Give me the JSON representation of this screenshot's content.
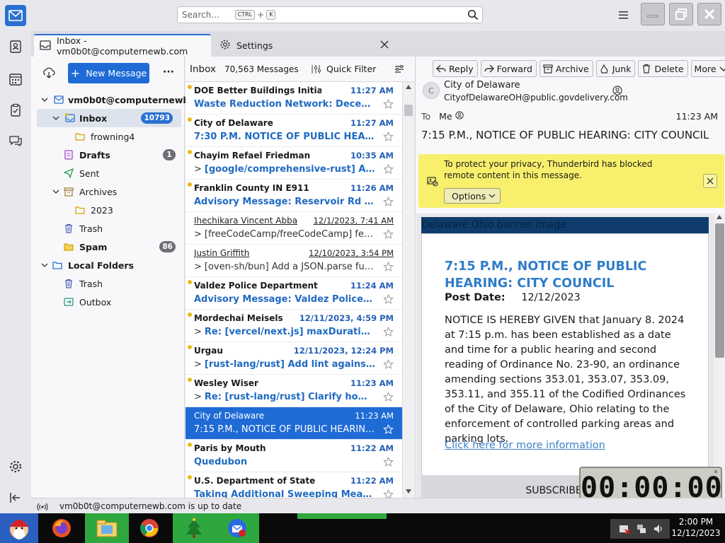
{
  "toolbar_top": {
    "search_placeholder": "Search...",
    "search_key1": "CTRL",
    "search_plus": "+",
    "search_key2": "K"
  },
  "tabs": [
    {
      "label": "Inbox - vm0b0t@computernewb.com"
    },
    {
      "label": "Settings"
    }
  ],
  "folder_pane": {
    "new_message": "New Message",
    "account": "vm0b0t@computernewb....",
    "folders": [
      {
        "label": "Inbox",
        "badge": "10793"
      },
      {
        "label": "frowning4",
        "badge": ""
      },
      {
        "label": "Drafts",
        "badge": "1"
      },
      {
        "label": "Sent",
        "badge": ""
      },
      {
        "label": "Archives",
        "badge": ""
      },
      {
        "label": "2023",
        "badge": ""
      },
      {
        "label": "Trash",
        "badge": ""
      },
      {
        "label": "Spam",
        "badge": "86"
      },
      {
        "label": "Local Folders",
        "badge": ""
      },
      {
        "label": "Trash",
        "badge": ""
      },
      {
        "label": "Outbox",
        "badge": ""
      }
    ]
  },
  "message_list": {
    "title": "Inbox",
    "count": "70,563 Messages",
    "quick_filter": "Quick Filter",
    "messages": [
      {
        "from": "DOE Better Buildings Initiative",
        "date": "11:27 AM",
        "subject": "Waste Reduction Network: December 2...",
        "thread": false
      },
      {
        "from": "City of Delaware",
        "date": "11:27 AM",
        "subject": "7:30 P.M. NOTICE OF PUBLIC HEARING: ...",
        "thread": false
      },
      {
        "from": "Chayim Refael Friedman",
        "date": "10:35 AM",
        "subject": "[google/comprehensive-rust] Add ex...",
        "thread": true
      },
      {
        "from": "Franklin County IN E911",
        "date": "11:26 AM",
        "subject": "Advisory Message: Reservoir Rd just so...",
        "thread": false
      },
      {
        "from": "Ihechikara Vincent Abba",
        "date": "12/1/2023, 7:41 AM",
        "subject": "[freeCodeCamp/freeCodeCamp] feat(cu...",
        "thread": true
      },
      {
        "from": "Justin Griffith",
        "date": "12/10/2023, 3:54 PM",
        "subject": "[oven-sh/bun] Add a JSON.parse functio...",
        "thread": true
      },
      {
        "from": "Valdez Police Department",
        "date": "11:24 AM",
        "subject": "Advisory Message: Valdez Police Depart...",
        "thread": false
      },
      {
        "from": "Mordechai Meisels",
        "date": "12/11/2023, 4:59 PM",
        "subject": "Re: [vercel/next.js] maxDuration and ...",
        "thread": true
      },
      {
        "from": "Urgau",
        "date": "12/11/2023, 12:24 PM",
        "subject": "[rust-lang/rust] Add lint against func...",
        "thread": true
      },
      {
        "from": "Wesley Wiser",
        "date": "11:23 AM",
        "subject": "Re: [rust-lang/rust] Clarify how to ch...",
        "thread": true
      },
      {
        "from": "City of Delaware",
        "date": "11:23 AM",
        "subject": "7:15 P.M., NOTICE OF PUBLIC HEARING: CIT...",
        "thread": false
      },
      {
        "from": "Paris by Mouth",
        "date": "11:22 AM",
        "subject": "Quedubon",
        "thread": false
      },
      {
        "from": "U.S. Department of State",
        "date": "11:22 AM",
        "subject": "Taking Additional Sweeping Measures ...",
        "thread": false
      }
    ]
  },
  "reader": {
    "buttons": [
      "Reply",
      "Forward",
      "Archive",
      "Junk",
      "Delete",
      "More"
    ],
    "avatar_letter": "C",
    "from_name": "City of Delaware",
    "from_email": "CityofDelawareOH@public.govdelivery.com",
    "to_label": "To",
    "to_value": "Me",
    "time": "11:23 AM",
    "subject": "7:15 P.M., NOTICE OF PUBLIC HEARING: CITY COUNCIL",
    "privacy_text": "To protect your privacy, Thunderbird has blocked remote content in this message.",
    "options_label": "Options",
    "image_alt": "Delaware Ohio banner image",
    "notice_title": "7:15 P.M., NOTICE OF PUBLIC HEARING: CITY COUNCIL",
    "post_date_label": "Post Date:",
    "post_date": "12/12/2023",
    "body": "NOTICE IS HEREBY GIVEN that January 8. 2024 at 7:15 p.m. has been established as a date and time for a public hearing and second reading of Ordinance No. 23-90, an ordinance amending sections 353.01, 353.07, 353.09, 353.11, and 355.11 of the Codified Ordinances of the City of Delaware, Ohio relating to the enforcement of controlled parking areas and parking lots.",
    "link": "Click here for more information",
    "subscriber": "SUBSCRIBER SE"
  },
  "timer": "00:00:00",
  "status": "vm0b0t@computernewb.com is up to date",
  "clock": {
    "time": "2:00 PM",
    "date": "12/12/2023"
  }
}
